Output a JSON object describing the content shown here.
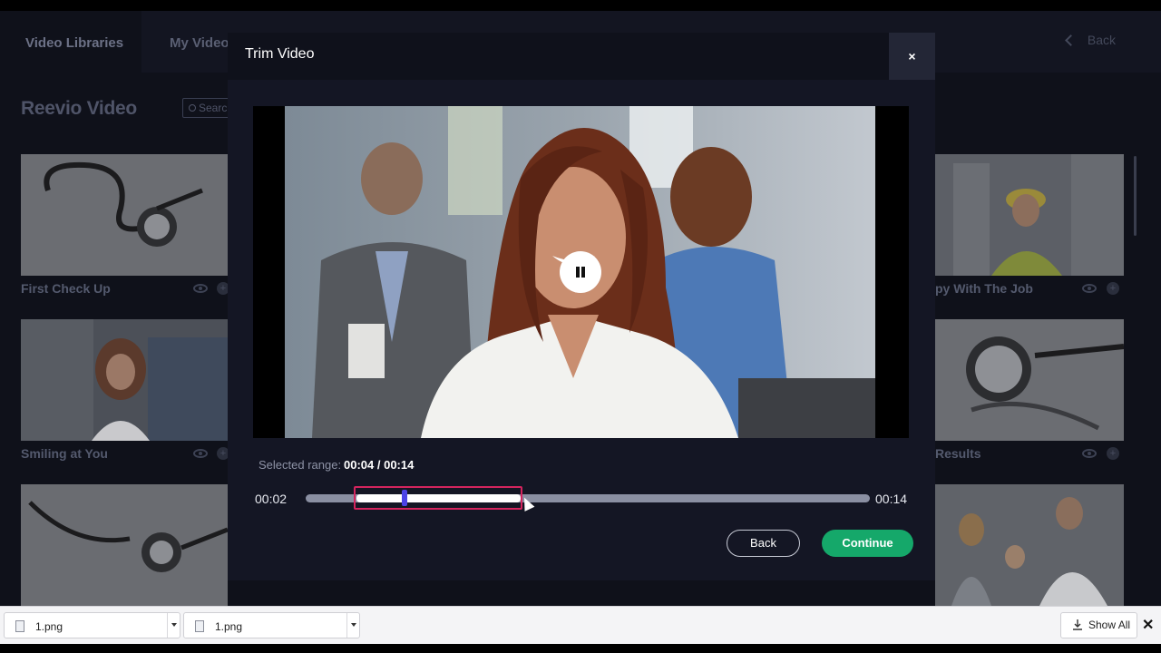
{
  "app": {
    "nav": {
      "tab_libraries": "Video Libraries",
      "tab_my_videos": "My Video",
      "back": "Back"
    },
    "library_title": "Reevio Video",
    "search_placeholder": "Searc",
    "tiles": [
      {
        "title": "First Check Up"
      },
      {
        "title": "py With The Job"
      },
      {
        "title": "Smiling at You"
      },
      {
        "title": "Results"
      }
    ]
  },
  "modal": {
    "title": "Trim Video",
    "close": "×",
    "selected_range_label": "Selected range:",
    "selected_range_value": "00:04 / 00:14",
    "start_time": "00:02",
    "end_time": "00:14",
    "back_button": "Back",
    "continue_button": "Continue"
  },
  "downloads": {
    "items": [
      {
        "name": "1.png"
      },
      {
        "name": "1.png"
      }
    ],
    "show_all": "Show All",
    "close": "✕"
  },
  "colors": {
    "accent_green": "#15a86a",
    "selection_border": "#d4245e",
    "playhead": "#4b43e6"
  }
}
